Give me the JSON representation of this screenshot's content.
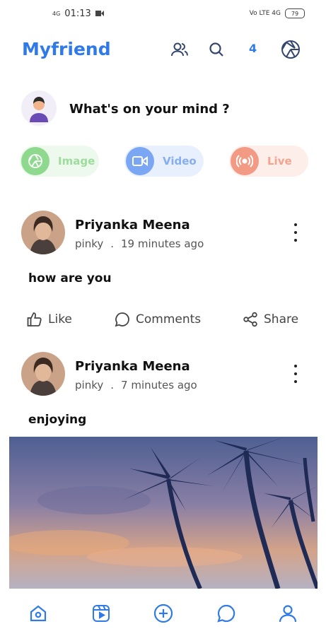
{
  "status_bar": {
    "time": "01:13",
    "signal_left": "4G",
    "network_right": "Vo LTE 4G",
    "battery": "79"
  },
  "header": {
    "brand": "Myfriend",
    "friends_icon": "people-icon",
    "search_icon": "search-icon",
    "notification_count": "4",
    "settings_icon": "aperture-icon"
  },
  "composer": {
    "prompt": "What's on your mind ?"
  },
  "quick_actions": [
    {
      "label": "Image",
      "icon": "image-icon",
      "color": "#7fd27f",
      "bg": "#eef9ee"
    },
    {
      "label": "Video",
      "icon": "video-icon",
      "color": "#6f9df2",
      "bg": "#e9f0fd"
    },
    {
      "label": "Live",
      "icon": "live-icon",
      "color": "#f0907a",
      "bg": "#fdeeea"
    }
  ],
  "posts": [
    {
      "author": "Priyanka Meena",
      "handle": "pinky",
      "separator": ".",
      "time": "19 minutes ago",
      "text": "how are you",
      "actions": {
        "like": "Like",
        "comments": "Comments",
        "share": "Share"
      }
    },
    {
      "author": "Priyanka Meena",
      "handle": "pinky",
      "separator": ".",
      "time": "7 minutes ago",
      "text": "enjoying"
    }
  ],
  "bottom_nav": [
    "home-icon",
    "reels-icon",
    "add-icon",
    "chat-icon",
    "profile-icon"
  ],
  "colors": {
    "accent": "#2f7ae8"
  }
}
